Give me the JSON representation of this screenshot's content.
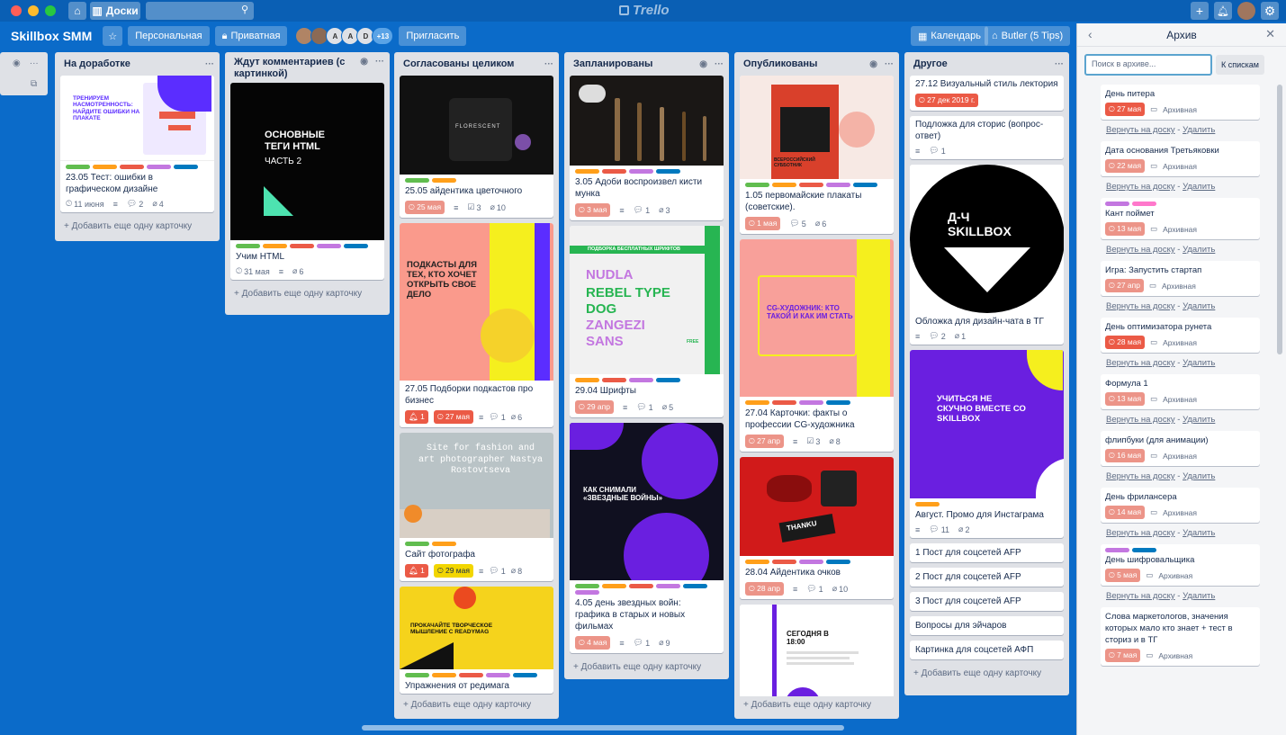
{
  "colors": {
    "green": "#61bd4f",
    "orange": "#ff9f1a",
    "red": "#eb5a46",
    "purple": "#c377e0",
    "blue": "#0079bf",
    "yellow": "#f2d600",
    "lightred": "#ec9488"
  },
  "topbar": {
    "boards_label": "Доски",
    "logo_text": "Trello"
  },
  "board": {
    "title": "Skillbox SMM",
    "team_label": "Персональная",
    "visibility_label": "Приватная",
    "member_initials": [
      "A",
      "A",
      "D"
    ],
    "extra_members": "+13",
    "invite_label": "Пригласить",
    "calendar_label": "Календарь",
    "butler_label": "Butler (5 Tips)"
  },
  "add_card_label": "+ Добавить еще одну карточку",
  "lists": {
    "l1": {
      "title": "На доработке",
      "c1": {
        "title": "23.05 Тест: ошибки в графическом дизайне",
        "image_text": "ТРЕНИРУЕМ НАСМОТРЕННОСТЬ: НАЙДИТЕ ОШИБКИ НА ПЛАКАТЕ",
        "date": "11 июня",
        "comments": "2",
        "attachments": "4"
      }
    },
    "l2": {
      "title": "Ждут комментариев (с картинкой)",
      "c1": {
        "title": "Учим HTML",
        "image_text": "ОСНОВНЫЕ ТЕГИ HTML",
        "image_sub": "ЧАСТЬ 2",
        "date": "31 мая",
        "attachments": "6"
      }
    },
    "l3": {
      "title": "Согласованы целиком",
      "c1": {
        "title": "25.05 айдентика цветочного",
        "image_text": "FLORESCENT",
        "due": "25 мая",
        "checklist": "3",
        "attachments": "10"
      },
      "c2": {
        "title": "27.05 Подборки подкастов про бизнес",
        "image_text": "ПОДКАСТЫ ДЛЯ ТЕХ, КТО ХОЧЕТ ОТКРЫТЬ СВОЕ ДЕЛО",
        "notif": "1",
        "due": "27 мая",
        "comments": "1",
        "attachments": "6"
      },
      "c3": {
        "title": "Сайт фотографа",
        "image_text": "Site for fashion and art photographer Nastya Rostovtseva",
        "notif": "1",
        "due": "29 мая",
        "comments": "1",
        "attachments": "8"
      },
      "c4": {
        "title": "Упражнения от редимага",
        "image_text": "ПРОКАЧАЙТЕ ТВОРЧЕСКОЕ МЫШЛЕНИЕ С READYMAG"
      }
    },
    "l4": {
      "title": "Запланированы",
      "c1": {
        "title": "3.05 Адоби воспроизвел кисти мунка",
        "due": "3 мая",
        "comments": "1",
        "attachments": "3"
      },
      "c2": {
        "title": "29.04 Шрифты",
        "image_head": "ПОДБОРКА БЕСПЛАТНЫХ ШРИФТОВ",
        "image_fonts": [
          "NUDLA",
          "REBEL TYPE",
          "DOG",
          "ZANGEZI",
          "SANS"
        ],
        "image_free": "FREE",
        "due": "29 апр",
        "comments": "1",
        "attachments": "5"
      },
      "c3": {
        "title": "4.05 день звездных войн: графика в старых и новых фильмах",
        "image_text": "КАК СНИМАЛИ «ЗВЕЗДНЫЕ ВОЙНЫ»",
        "due": "4 мая",
        "comments": "1",
        "attachments": "9"
      }
    },
    "l5": {
      "title": "Опубликованы",
      "c1": {
        "title": "1.05 первомайские плакаты (советские).",
        "image_text": "ВСЕРОССИЙСКИЙ СУББОТНИК",
        "due": "1 мая",
        "comments": "5",
        "attachments": "6"
      },
      "c2": {
        "title": "27.04 Карточки: факты о профессии CG-художника",
        "image_text": "CG-ХУДОЖНИК: КТО ТАКОЙ И КАК ИМ СТАТЬ",
        "due": "27 апр",
        "checklist": "3",
        "attachments": "8"
      },
      "c3": {
        "title": "28.04 Айдентика очков",
        "image_text": "THANKU",
        "due": "28 апр",
        "comments": "1",
        "attachments": "10"
      },
      "c4": {
        "image_text": "СЕГОДНЯ В 18:00"
      }
    },
    "l6": {
      "title": "Другое",
      "c1": {
        "title": "27.12 Визуальный стиль лектория",
        "due": "27 дек 2019 г."
      },
      "c2": {
        "title": "Подложка для сторис (вопрос-ответ)",
        "comments": "1"
      },
      "c3": {
        "title": "Обложка для дизайн-чата в ТГ",
        "image_text": "Д-Ч SKILLBOX",
        "comments": "2",
        "attachments": "1"
      },
      "c4": {
        "title": "Август. Промо для Инстаграма",
        "image_text": "УЧИТЬСЯ НЕ СКУЧНО ВМЕСТЕ СО SKILLBOX",
        "comments": "11",
        "attachments": "2"
      },
      "simple": [
        "1 Пост для соцсетей AFP",
        "2 Пост для соцсетей AFP",
        "3 Пост для соцсетей AFP",
        "Вопросы для эйчаров",
        "Картинка для соцсетей АФП"
      ]
    }
  },
  "archive": {
    "title": "Архив",
    "search_placeholder": "Поиск в архиве...",
    "to_lists_label": "К спискам",
    "archived_label": "Архивная",
    "return_label": "Вернуть на доску",
    "delete_label": "Удалить",
    "items": [
      {
        "title": "День питера",
        "due": "27 мая"
      },
      {
        "title": "Дата основания Третьяковки",
        "due": "22 мая"
      },
      {
        "title": "Кант поймет",
        "due": "13 мая"
      },
      {
        "title": "Игра: Запустить стартап",
        "due": "27 апр"
      },
      {
        "title": "День оптимизатора рунета",
        "due": "28 мая"
      },
      {
        "title": "Формула 1",
        "due": "13 мая"
      },
      {
        "title": "флипбуки (для анимации)",
        "due": "16 мая"
      },
      {
        "title": "День фрилансера",
        "due": "14 мая"
      },
      {
        "title": "День шифровальщика",
        "due": "5 мая"
      },
      {
        "title": "Слова маркетологов, значения которых мало кто знает + тест в сториз и в ТГ",
        "due": "7 мая"
      }
    ]
  }
}
